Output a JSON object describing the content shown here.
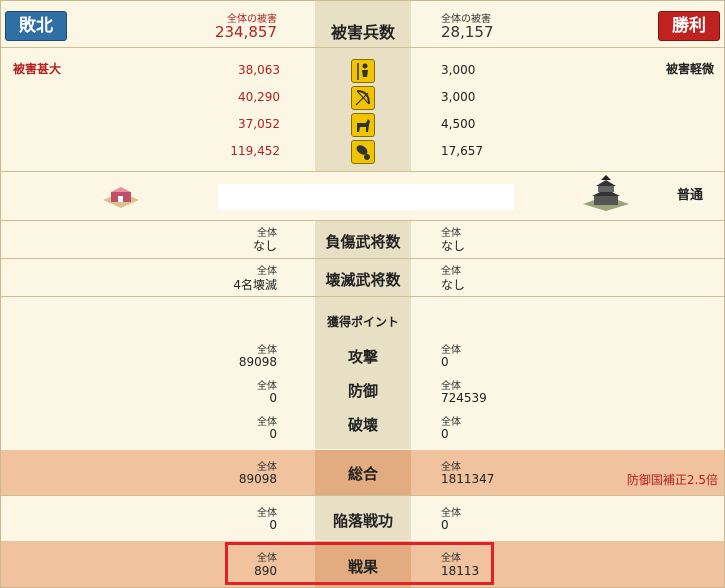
{
  "header": {
    "left_badge": "敗北",
    "right_badge": "勝利",
    "title": "被害兵数",
    "left_total_label": "全体の被害",
    "left_total_value": "234,857",
    "right_total_label": "全体の被害",
    "right_total_value": "28,157"
  },
  "damage": {
    "left_status": "被害甚大",
    "right_status": "被害軽微",
    "rows": [
      {
        "icon": "spear-soldier-icon",
        "left": "38,063",
        "right": "3,000"
      },
      {
        "icon": "bow-icon",
        "left": "40,290",
        "right": "3,000"
      },
      {
        "icon": "horse-icon",
        "left": "37,052",
        "right": "4,500"
      },
      {
        "icon": "siege-weapon-icon",
        "left": "119,452",
        "right": "17,657"
      }
    ]
  },
  "location": {
    "left_icon": "village-icon",
    "right_icon": "castle-icon",
    "right_label": "普通"
  },
  "injured": {
    "label": "負傷武将数",
    "left_small": "全体",
    "left": "なし",
    "right_small": "全体",
    "right": "なし"
  },
  "destroyed": {
    "label": "壊滅武将数",
    "left_small": "全体",
    "left": "4名壊滅",
    "right_small": "全体",
    "right": "なし"
  },
  "points": {
    "title": "獲得ポイント",
    "rows": [
      {
        "label": "攻撃",
        "left_small": "全体",
        "left": "89098",
        "right_small": "全体",
        "right": "0"
      },
      {
        "label": "防御",
        "left_small": "全体",
        "left": "0",
        "right_small": "全体",
        "right": "724539"
      },
      {
        "label": "破壊",
        "left_small": "全体",
        "left": "0",
        "right_small": "全体",
        "right": "0"
      }
    ]
  },
  "total": {
    "label": "総合",
    "left_small": "全体",
    "left": "89098",
    "right_small": "全体",
    "right": "1811347",
    "note": "防御国補正2.5倍"
  },
  "fall": {
    "label": "陥落戦功",
    "left_small": "全体",
    "left": "0",
    "right_small": "全体",
    "right": "0"
  },
  "result": {
    "label": "戦果",
    "left_small": "全体",
    "left": "890",
    "right_small": "全体",
    "right": "18113"
  },
  "colors": {
    "defeat": "#2f6fa6",
    "victory": "#c0231f",
    "highlight_box": "#e0202a",
    "orange_row": "#f0c29e"
  }
}
